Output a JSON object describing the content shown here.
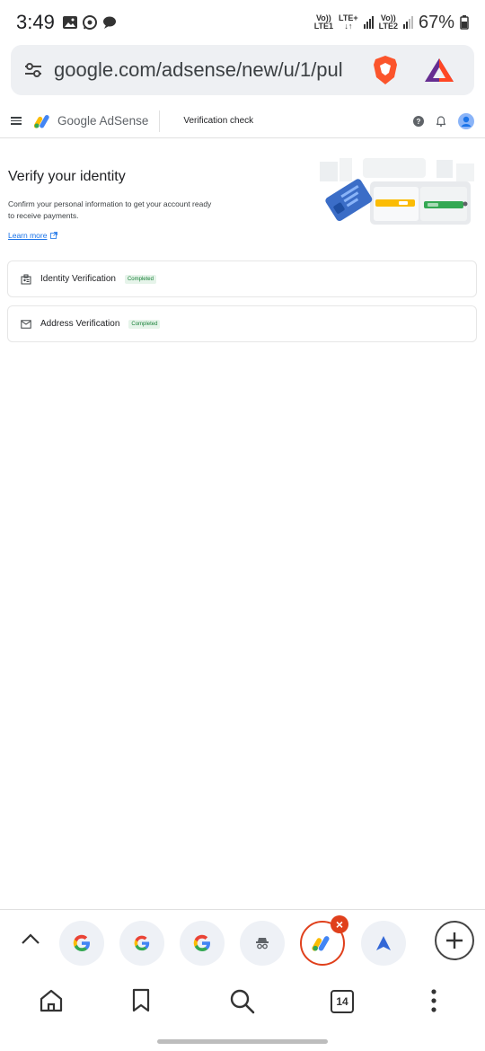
{
  "status_bar": {
    "time": "3:49",
    "net1_top": "Vo))",
    "net1_bottom": "LTE1",
    "net1_type": "LTE+",
    "net2_top": "Vo))",
    "net2_bottom": "LTE2",
    "battery": "67%"
  },
  "browser": {
    "url": "google.com/adsense/new/u/1/pul",
    "tab_count": "14"
  },
  "header": {
    "brand": "Google AdSense",
    "page_name": "Verification check"
  },
  "main": {
    "title": "Verify your identity",
    "description": "Confirm your personal information to get your account ready to receive payments.",
    "learn_more": "Learn more"
  },
  "cards": [
    {
      "label": "Identity Verification",
      "status": "Completed"
    },
    {
      "label": "Address Verification",
      "status": "Completed"
    }
  ],
  "colors": {
    "accent": "#1a73e8",
    "success_text": "#188038",
    "success_bg": "#e6f4ea",
    "active_tab": "#e0401c"
  }
}
